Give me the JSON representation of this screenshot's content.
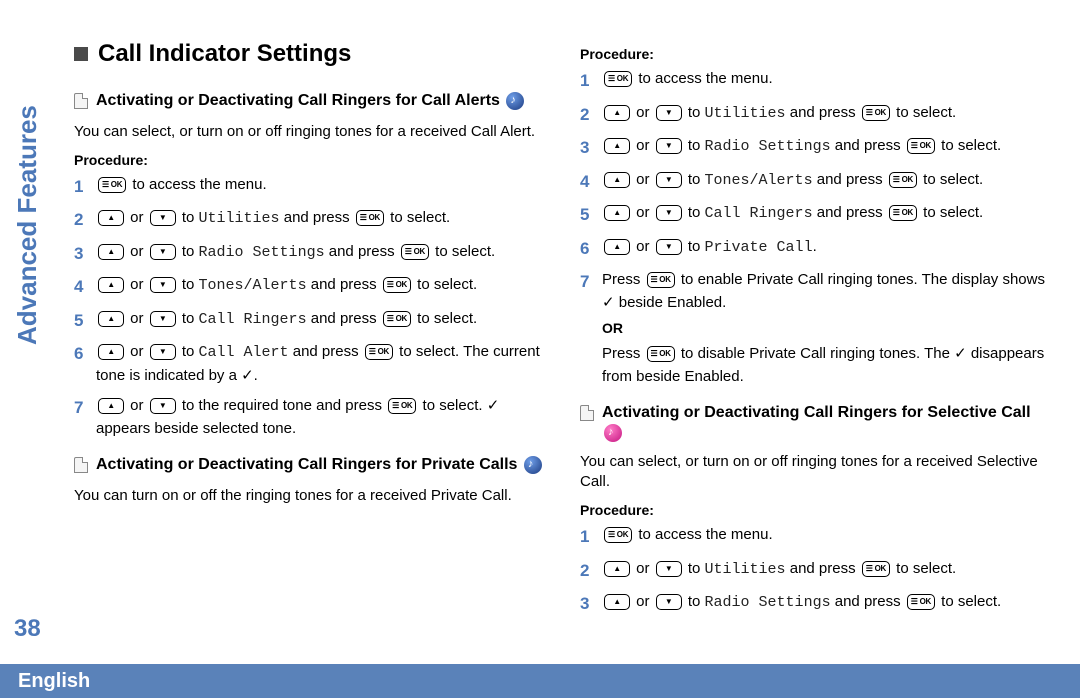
{
  "page": {
    "number": "38",
    "language": "English",
    "vert_label": "Advanced Features"
  },
  "h1": "Call Indicator Settings",
  "sec1": {
    "title": "Activating or Deactivating Call Ringers for Call Alerts",
    "body": "You can select, or turn on or off ringing tones for a received Call Alert.",
    "proc_label": "Procedure:",
    "steps": {
      "n1": "1",
      "s1_a": " to access the menu.",
      "n2": "2",
      "s2_or": " or ",
      "s2_a": " to ",
      "s2_m": "Utilities",
      "s2_b": " and press ",
      "s2_c": " to select.",
      "n3": "3",
      "s3_m": "Radio Settings",
      "n4": "4",
      "s4_m": "Tones/Alerts",
      "n5": "5",
      "s5_m": "Call Ringers",
      "n6": "6",
      "s6_m": "Call Alert",
      "s6_tail": " to select. The current tone is indicated by a ✓.",
      "n7": "7",
      "s7_a": " to the required tone and press ",
      "s7_c": " to select. ✓ appears beside selected tone."
    }
  },
  "sec2": {
    "title": "Activating or Deactivating Call Ringers for Private Calls",
    "body": "You can turn on or off the ringing tones for a received Private Call."
  },
  "sec2b": {
    "proc_label": "Procedure:",
    "steps": {
      "n1": "1",
      "s1_a": " to access the menu.",
      "n2": "2",
      "s2_m": "Utilities",
      "n3": "3",
      "s3_m": "Radio Settings",
      "n4": "4",
      "s4_m": "Tones/Alerts",
      "n5": "5",
      "s5_m": "Call Ringers",
      "n6": "6",
      "s6_m": "Private Call",
      "s6_end": ".",
      "n7": "7",
      "s7_a": "Press ",
      "s7_b": " to enable Private Call ringing tones. The display shows ✓ beside Enabled.",
      "or": "OR",
      "s7_c": "Press ",
      "s7_d": " to disable Private Call ringing tones. The ✓ disappears from beside Enabled."
    },
    "common": {
      "or": " or ",
      "to": " to ",
      "press": " and press ",
      "sel": " to select."
    }
  },
  "sec3": {
    "title": "Activating or Deactivating Call Ringers for Selective Call",
    "body": "You can select, or turn on or off ringing tones for a received Selective Call.",
    "proc_label": "Procedure:",
    "steps": {
      "n1": "1",
      "s1_a": " to access the menu.",
      "n2": "2",
      "s2_m": "Utilities",
      "n3": "3",
      "s3_m": "Radio Settings"
    }
  }
}
